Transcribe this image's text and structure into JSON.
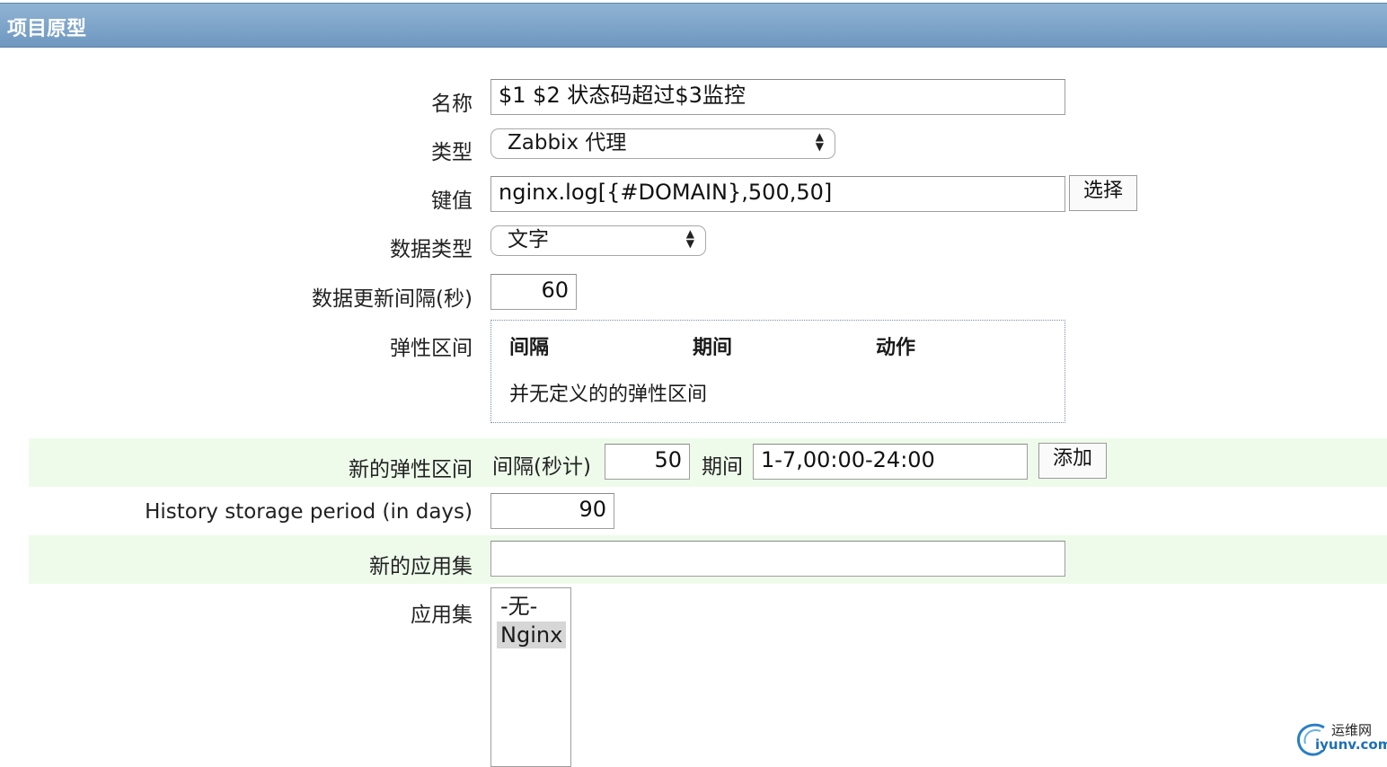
{
  "header": {
    "title": "项目原型"
  },
  "form": {
    "name": {
      "label": "名称",
      "value": "$1 $2 状态码超过$3监控"
    },
    "type": {
      "label": "类型",
      "value": "Zabbix 代理"
    },
    "key": {
      "label": "键值",
      "value": "nginx.log[{#DOMAIN},500,50]",
      "button": "选择"
    },
    "data_type": {
      "label": "数据类型",
      "value": "文字"
    },
    "update_interval": {
      "label": "数据更新间隔(秒)",
      "value": "60"
    },
    "flexible_intervals": {
      "label": "弹性区间",
      "columns": [
        "间隔",
        "期间",
        "动作"
      ],
      "empty_text": "并无定义的的弹性区间"
    },
    "new_flexible_interval": {
      "label": "新的弹性区间",
      "interval_label": "间隔(秒计)",
      "interval_value": "50",
      "period_label": "期间",
      "period_value": "1-7,00:00-24:00",
      "add_button": "添加"
    },
    "history": {
      "label": "History storage period (in days)",
      "value": "90"
    },
    "new_application": {
      "label": "新的应用集",
      "value": ""
    },
    "applications": {
      "label": "应用集",
      "options": [
        "-无-",
        "Nginx"
      ],
      "selected": "Nginx"
    }
  },
  "watermark": {
    "cn": "运维网",
    "en": "iyunv.com"
  }
}
